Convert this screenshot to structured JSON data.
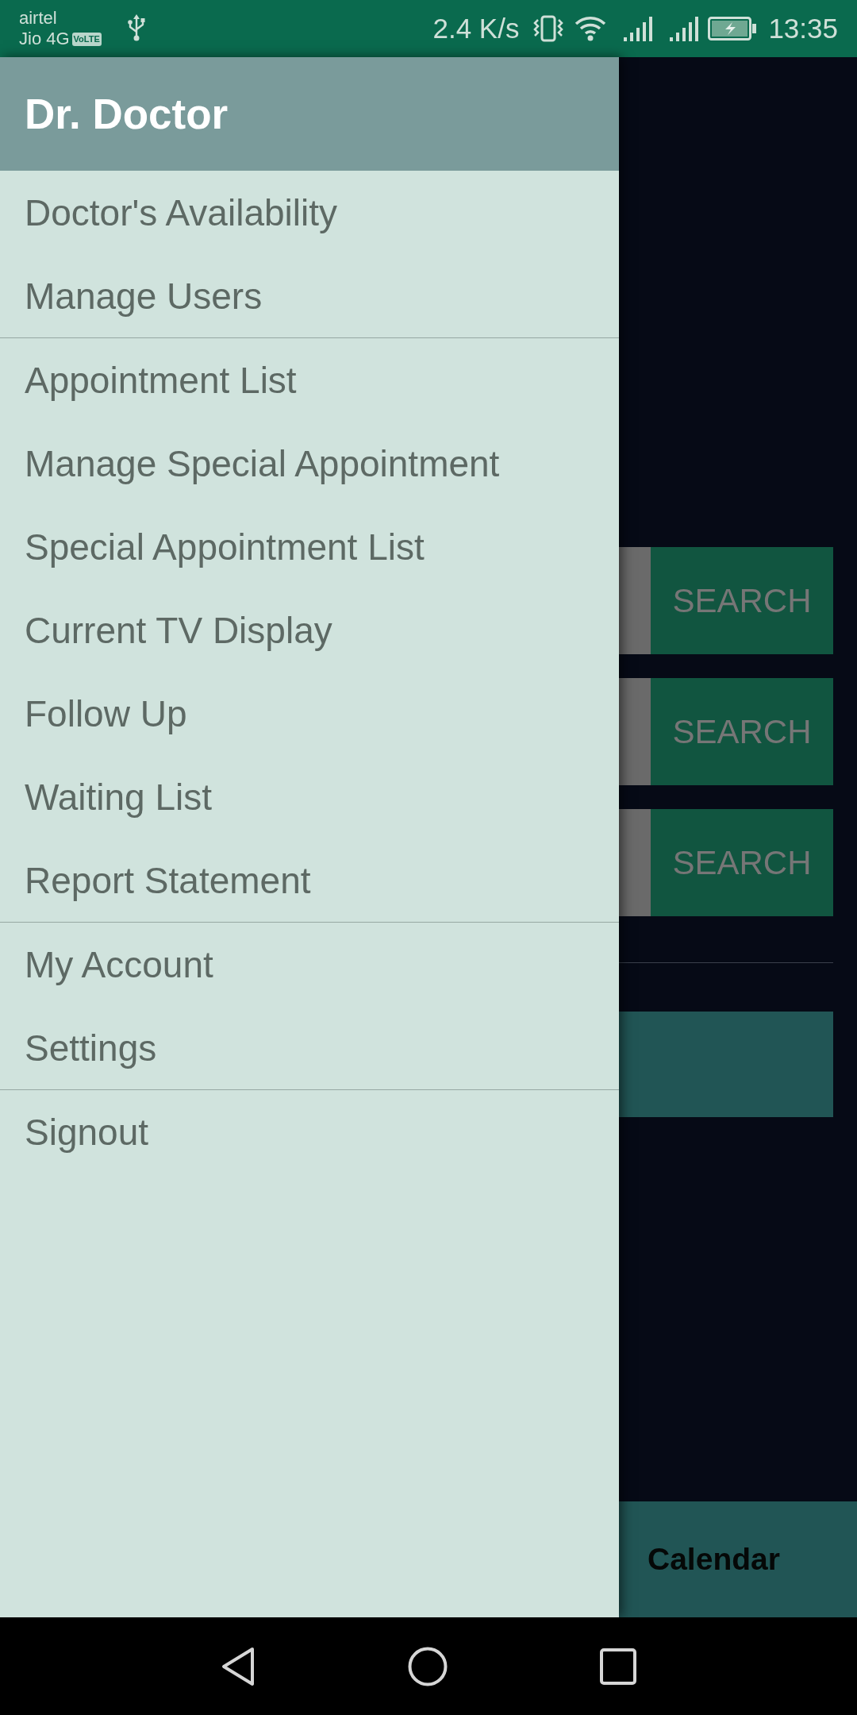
{
  "status_bar": {
    "carriers": [
      "airtel",
      "Jio 4G"
    ],
    "network_badge": "VoLTE",
    "data_speed": "2.4 K/s",
    "time": "13:35"
  },
  "drawer": {
    "title": "Dr. Doctor",
    "sections": [
      {
        "items": [
          {
            "label": "Doctor's Availability"
          },
          {
            "label": "Manage Users"
          }
        ]
      },
      {
        "items": [
          {
            "label": "Appointment List"
          },
          {
            "label": "Manage Special Appointment"
          },
          {
            "label": "Special Appointment List"
          },
          {
            "label": "Current TV Display"
          },
          {
            "label": "Follow Up"
          },
          {
            "label": "Waiting List"
          },
          {
            "label": "Report Statement"
          }
        ]
      },
      {
        "items": [
          {
            "label": "My Account"
          },
          {
            "label": "Settings"
          }
        ]
      },
      {
        "items": [
          {
            "label": "Signout"
          }
        ]
      }
    ]
  },
  "background_screen": {
    "search_rows": [
      {
        "button": "SEARCH"
      },
      {
        "button": "SEARCH"
      },
      {
        "button": "SEARCH"
      }
    ],
    "bottom_tab": "Calendar"
  }
}
